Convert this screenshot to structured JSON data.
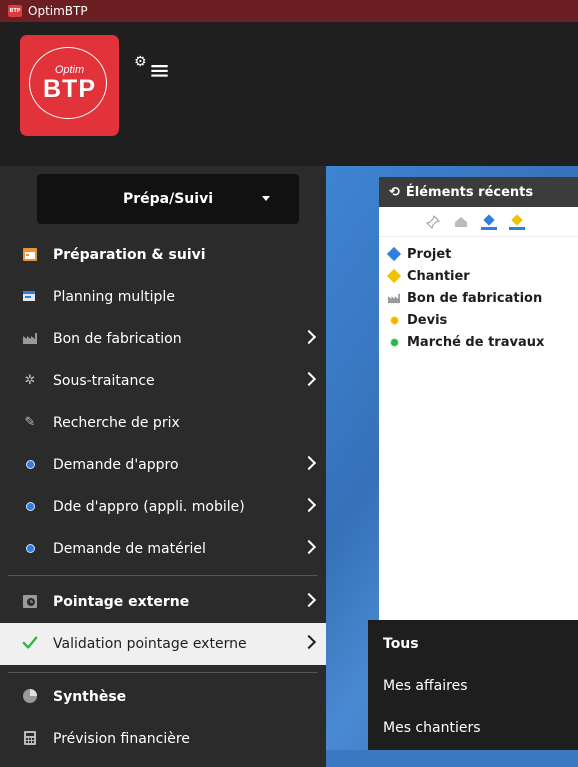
{
  "window": {
    "title": "OptimBTP",
    "app_icon_text": "BTP"
  },
  "logo": {
    "optim": "Optim",
    "btp": "BTP"
  },
  "icons": {
    "gear": "gear-icon",
    "menu": "hamburger-menu-icon"
  },
  "sidebar": {
    "dropdown_label": "Prépa/Suivi",
    "items": [
      {
        "label": "Préparation & suivi"
      },
      {
        "label": "Planning multiple"
      },
      {
        "label": "Bon de fabrication"
      },
      {
        "label": "Sous-traitance"
      },
      {
        "label": "Recherche de prix"
      },
      {
        "label": "Demande d'appro"
      },
      {
        "label": "Dde d'appro (appli. mobile)"
      },
      {
        "label": "Demande de matériel"
      },
      {
        "label": "Pointage externe"
      },
      {
        "label": "Validation pointage externe"
      },
      {
        "label": "Synthèse"
      },
      {
        "label": "Prévision financière"
      }
    ]
  },
  "submenu": {
    "items": [
      "Tous",
      "Mes affaires",
      "Mes chantiers"
    ],
    "selected": "Tous"
  },
  "recent": {
    "title": "Éléments récents",
    "items": [
      {
        "label": "Projet"
      },
      {
        "label": "Chantier"
      },
      {
        "label": "Bon de fabrication"
      },
      {
        "label": "Devis"
      },
      {
        "label": "Marché de travaux"
      }
    ]
  },
  "colors": {
    "accent_red": "#e2323a",
    "title_bar": "#6b1f22",
    "check_green": "#2fb344",
    "content_blue": "#3a78c4"
  }
}
